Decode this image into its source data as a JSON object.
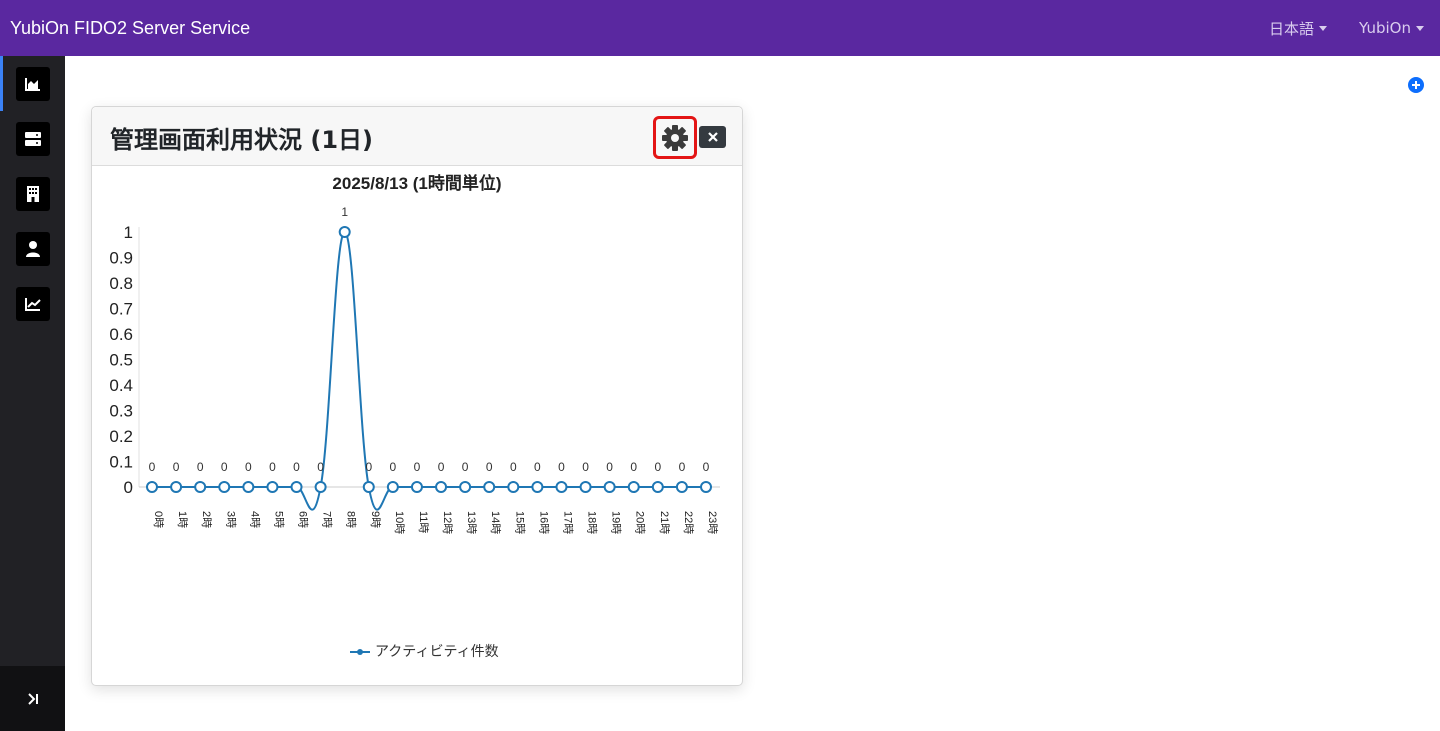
{
  "app": {
    "title": "YubiOn FIDO2 Server Service"
  },
  "topbar": {
    "language_menu": "日本語",
    "user_menu": "YubiOn"
  },
  "sidebar": {
    "items": [
      {
        "icon": "area-chart-icon",
        "active": true
      },
      {
        "icon": "server-icon",
        "active": false
      },
      {
        "icon": "building-icon",
        "active": false
      },
      {
        "icon": "user-icon",
        "active": false
      },
      {
        "icon": "line-chart-icon",
        "active": false
      }
    ],
    "collapse_icon": "collapse-sidebar-icon"
  },
  "widget": {
    "title": "管理画面利用状況 (1日)",
    "settings_icon": "gear-icon",
    "close_icon": "close-icon"
  },
  "chart_data": {
    "type": "line",
    "title": "2025/8/13 (1時間単位)",
    "categories": [
      "0時",
      "1時",
      "2時",
      "3時",
      "4時",
      "5時",
      "6時",
      "7時",
      "8時",
      "9時",
      "10時",
      "11時",
      "12時",
      "13時",
      "14時",
      "15時",
      "16時",
      "17時",
      "18時",
      "19時",
      "20時",
      "21時",
      "22時",
      "23時"
    ],
    "series": [
      {
        "name": "アクティビティ件数",
        "values": [
          0,
          0,
          0,
          0,
          0,
          0,
          0,
          0,
          1,
          0,
          0,
          0,
          0,
          0,
          0,
          0,
          0,
          0,
          0,
          0,
          0,
          0,
          0,
          0
        ]
      }
    ],
    "y_ticks": [
      "0",
      "0.1",
      "0.2",
      "0.3",
      "0.4",
      "0.5",
      "0.6",
      "0.7",
      "0.8",
      "0.9",
      "1"
    ],
    "ylim": [
      0,
      1
    ],
    "legend": "bottom-center",
    "color": "#1f77b4"
  }
}
